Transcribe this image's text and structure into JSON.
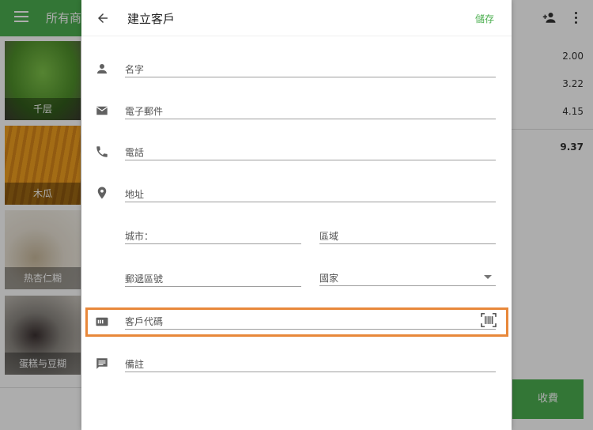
{
  "background": {
    "title": "所有商",
    "tiles": [
      {
        "label": "千层"
      },
      {
        "label": "木瓜"
      },
      {
        "label": "热杏仁糊"
      },
      {
        "label": "蛋糕与豆糊"
      }
    ],
    "amounts": [
      "2.00",
      "3.22",
      "4.15",
      "9.37"
    ],
    "charge_label": "收費"
  },
  "dialog": {
    "title": "建立客戶",
    "save_label": "儲存",
    "fields": {
      "name": "名字",
      "email": "電子郵件",
      "phone": "電話",
      "address": "地址",
      "city": "城市：",
      "region": "區域",
      "postal": "郵遞區號",
      "country": "國家",
      "customer_code": "客戶代碼",
      "note": "備註"
    }
  },
  "colors": {
    "accent": "#4caf50",
    "highlight": "#e8883a"
  }
}
